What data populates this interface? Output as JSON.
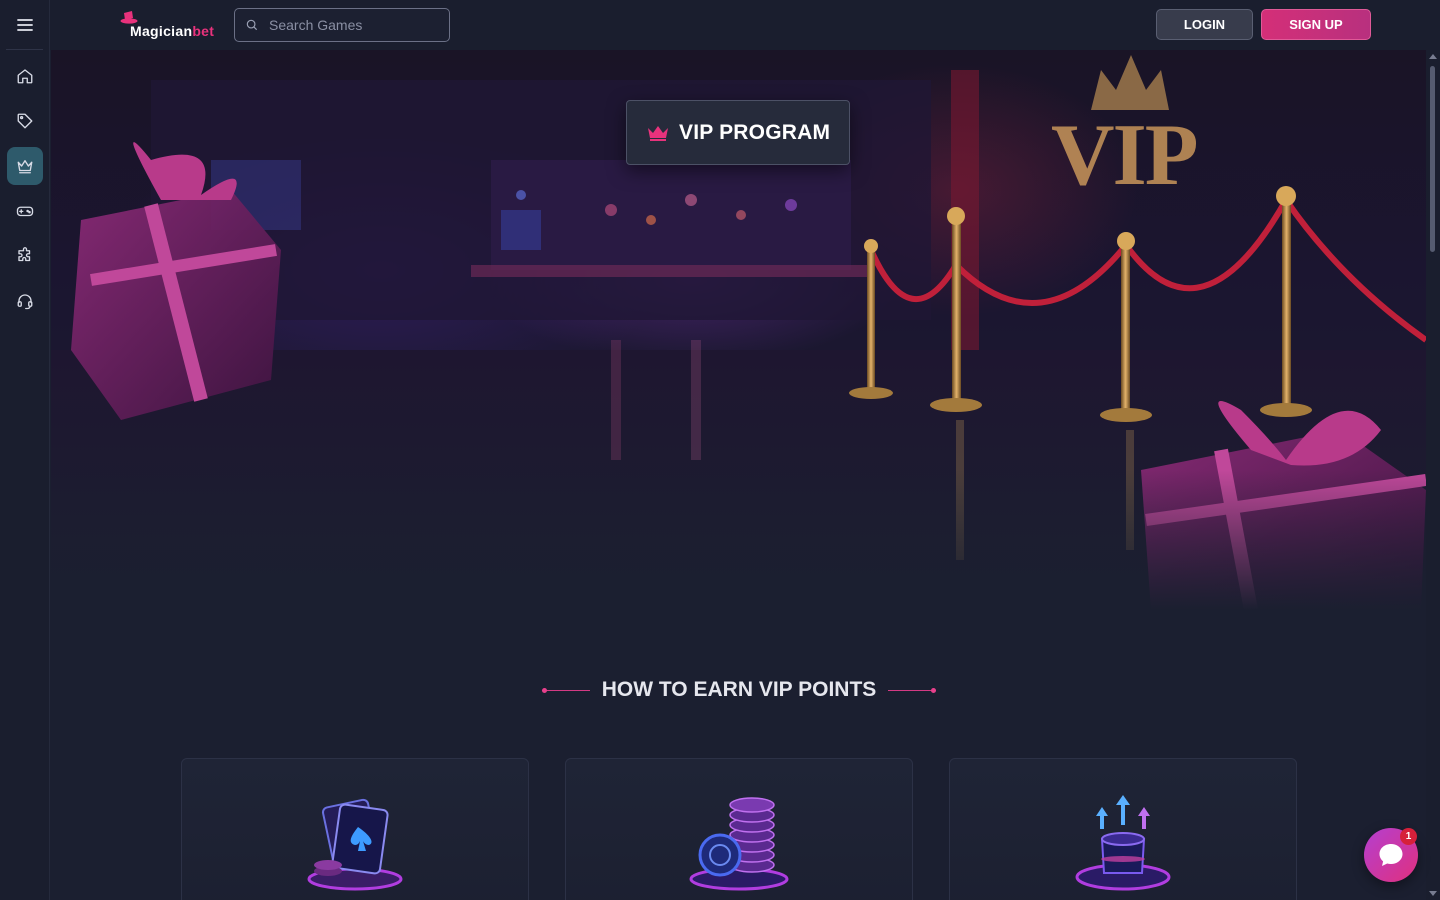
{
  "brand": {
    "name_part1": "Magician",
    "name_part2": "bet",
    "accent": "#e8327c"
  },
  "header": {
    "search_placeholder": "Search Games",
    "login_label": "LOGIN",
    "signup_label": "SIGN UP"
  },
  "sidebar": {
    "items": [
      {
        "icon": "home-icon",
        "active": false
      },
      {
        "icon": "tag-icon",
        "active": false
      },
      {
        "icon": "crown-icon",
        "active": true
      },
      {
        "icon": "gamepad-icon",
        "active": false
      },
      {
        "icon": "puzzle-icon",
        "active": false
      },
      {
        "icon": "headset-icon",
        "active": false
      }
    ]
  },
  "hero": {
    "badge_label": "VIP PROGRAM",
    "sign_text": "VIP"
  },
  "section": {
    "title": "HOW TO EARN VIP POINTS"
  },
  "cards": [
    {
      "icon": "cards-chips-icon"
    },
    {
      "icon": "chip-stack-icon"
    },
    {
      "icon": "magic-hat-icon"
    }
  ],
  "chat": {
    "unread_count": "1"
  }
}
